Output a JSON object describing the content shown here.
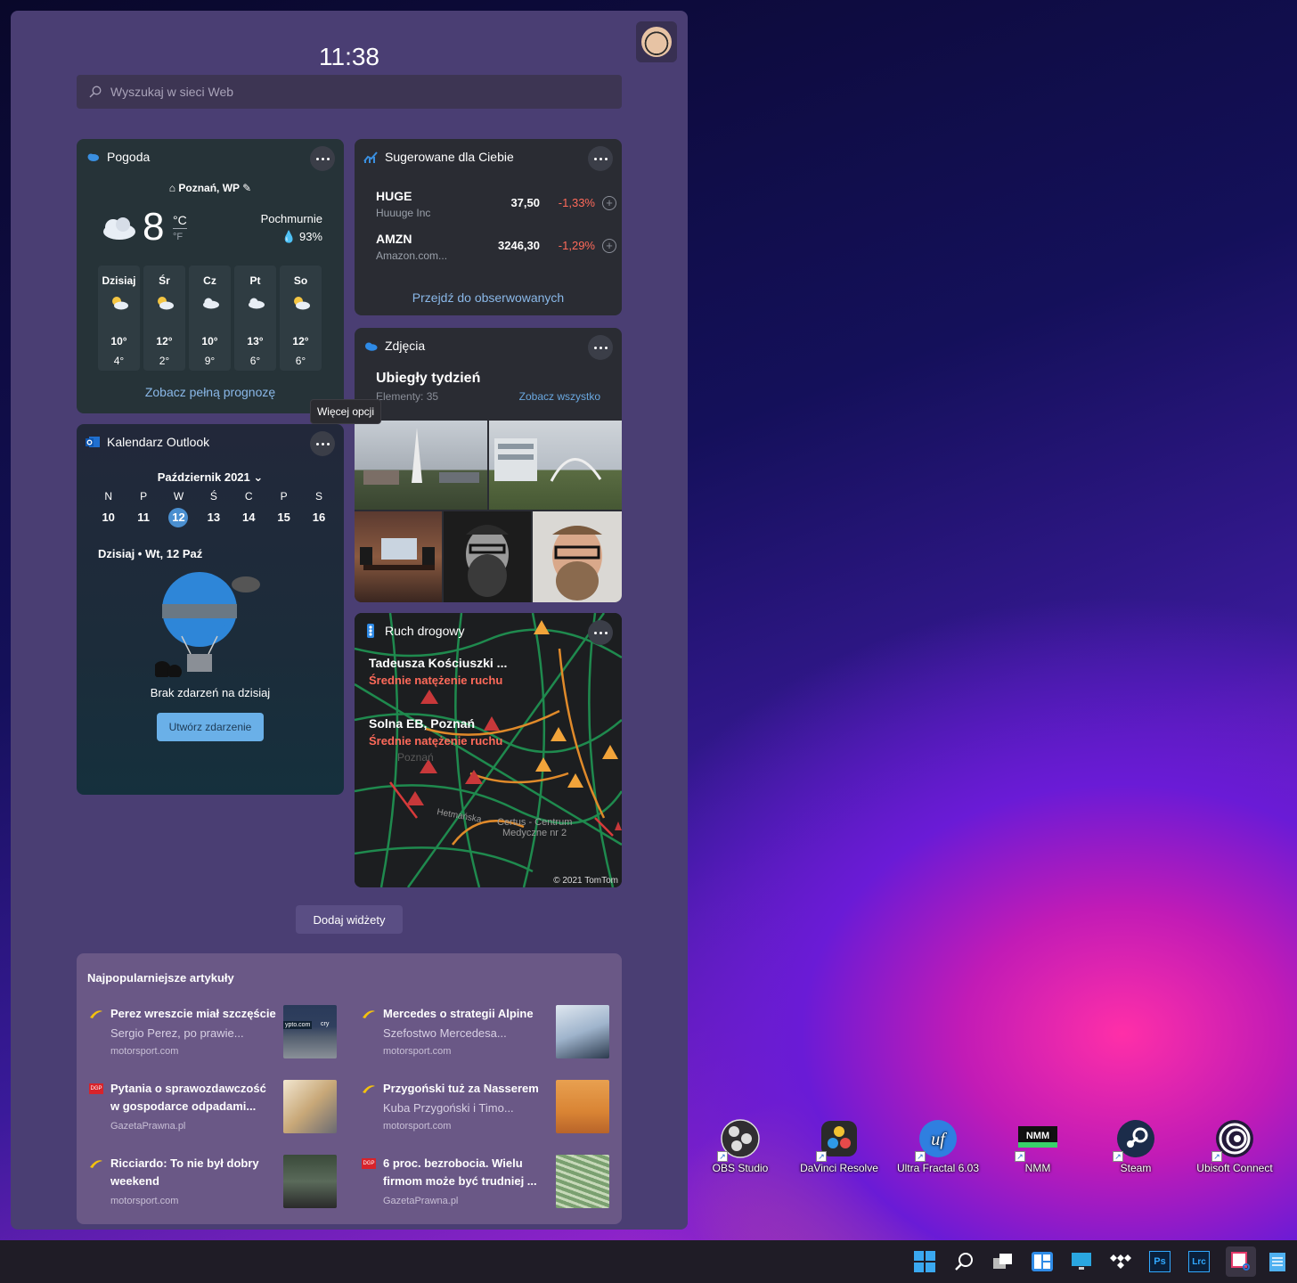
{
  "clock": "11:38",
  "search": {
    "placeholder": "Wyszukaj w sieci Web"
  },
  "weather": {
    "title": "Pogoda",
    "location": "Poznań, WP",
    "temp": "8",
    "unit_c": "°C",
    "unit_f": "°F",
    "condition": "Pochmurnie",
    "humidity": "93%",
    "days": [
      {
        "name": "Dzisiaj",
        "hi": "10°",
        "lo": "4°"
      },
      {
        "name": "Śr",
        "hi": "12°",
        "lo": "2°"
      },
      {
        "name": "Cz",
        "hi": "10°",
        "lo": "9°"
      },
      {
        "name": "Pt",
        "hi": "13°",
        "lo": "6°"
      },
      {
        "name": "So",
        "hi": "12°",
        "lo": "6°"
      }
    ],
    "link": "Zobacz pełną prognozę"
  },
  "stocks": {
    "title": "Sugerowane dla Ciebie",
    "items": [
      {
        "symbol": "HUGE",
        "company": "Huuuge Inc",
        "price": "37,50",
        "change": "-1,33%"
      },
      {
        "symbol": "AMZN",
        "company": "Amazon.com...",
        "price": "3246,30",
        "change": "-1,29%"
      }
    ],
    "link": "Przejdź do obserwowanych"
  },
  "photos": {
    "title": "Zdjęcia",
    "heading": "Ubiegły tydzień",
    "count": "Elementy: 35",
    "link": "Zobacz wszystko"
  },
  "tooltip": "Więcej opcji",
  "calendar": {
    "title": "Kalendarz Outlook",
    "month": "Październik 2021",
    "weekdays": [
      "N",
      "P",
      "W",
      "Ś",
      "C",
      "P",
      "S"
    ],
    "dates": [
      "10",
      "11",
      "12",
      "13",
      "14",
      "15",
      "16"
    ],
    "today_label": "Dzisiaj • Wt, 12 Paź",
    "no_events": "Brak zdarzeń na dzisiaj",
    "create": "Utwórz zdarzenie"
  },
  "traffic": {
    "title": "Ruch drogowy",
    "items": [
      {
        "road": "Tadeusza Kościuszki ...",
        "status": "Średnie natężenie ruchu"
      },
      {
        "road": "Solna EB, Poznań",
        "status": "Średnie natężenie ruchu"
      }
    ],
    "map_labels": [
      "Hetmańska",
      "Certus - Centrum",
      "Medyczne nr 2",
      "Poznań"
    ],
    "copyright": "© 2021 TomTom"
  },
  "add_widgets": "Dodaj widżety",
  "news": {
    "title": "Najpopularniejsze artykuły",
    "articles": [
      {
        "title": "Perez wreszcie miał szczęście",
        "desc": "Sergio Perez, po prawie...",
        "source": "motorsport.com"
      },
      {
        "title": "Mercedes o strategii Alpine",
        "desc": "Szefostwo Mercedesa...",
        "source": "motorsport.com"
      },
      {
        "title": "Pytania o sprawozdawczość w gospodarce odpadami...",
        "desc": "",
        "source": "GazetaPrawna.pl"
      },
      {
        "title": "Przygoński tuż za Nasserem",
        "desc": "Kuba Przygoński i Timo...",
        "source": "motorsport.com"
      },
      {
        "title": "Ricciardo: To nie był dobry weekend",
        "desc": "",
        "source": "motorsport.com"
      },
      {
        "title": "6 proc. bezrobocia. Wielu firmom może być trudniej ...",
        "desc": "",
        "source": "GazetaPrawna.pl"
      }
    ],
    "thumb_text": [
      "ypto.com",
      "cry"
    ]
  },
  "source_badges": {
    "gp": "DGP"
  },
  "desktop_icons": [
    {
      "label": "OBS Studio"
    },
    {
      "label": "DaVinci Resolve"
    },
    {
      "label": "Ultra Fractal 6.03",
      "glyph": "uf"
    },
    {
      "label": "NMM",
      "glyph": "NMM"
    },
    {
      "label": "Steam"
    },
    {
      "label": "Ubisoft Connect"
    }
  ],
  "taskbar": {
    "ps": "Ps",
    "lrc": "Lrc"
  }
}
